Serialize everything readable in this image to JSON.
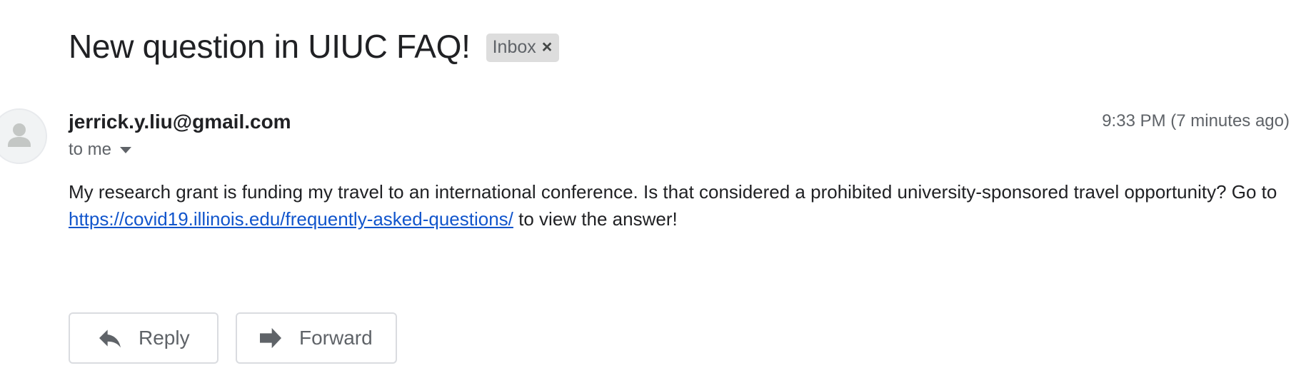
{
  "email": {
    "subject": "New question in UIUC FAQ!",
    "label": "Inbox",
    "label_remove_glyph": "×",
    "sender": "jerrick.y.liu@gmail.com",
    "timestamp": "9:33 PM (7 minutes ago)",
    "recipients": "to me",
    "body_text": "My research grant is funding my travel to an international conference. Is that considered a prohibited university-sponsored travel opportunity?  Go to ",
    "body_link": "https://covid19.illinois.edu/frequently-asked-questions/",
    "body_suffix": " to view the answer!"
  },
  "actions": {
    "reply_label": "Reply",
    "forward_label": "Forward"
  },
  "icons": {
    "avatar": "person-icon",
    "reply": "reply-icon",
    "forward": "forward-icon",
    "remove_label": "close-icon",
    "recipients_details": "chevron-down-icon"
  },
  "colors": {
    "link": "#1155cc",
    "label_chip_bg": "#dddddd",
    "secondary_text": "#5f6368"
  }
}
